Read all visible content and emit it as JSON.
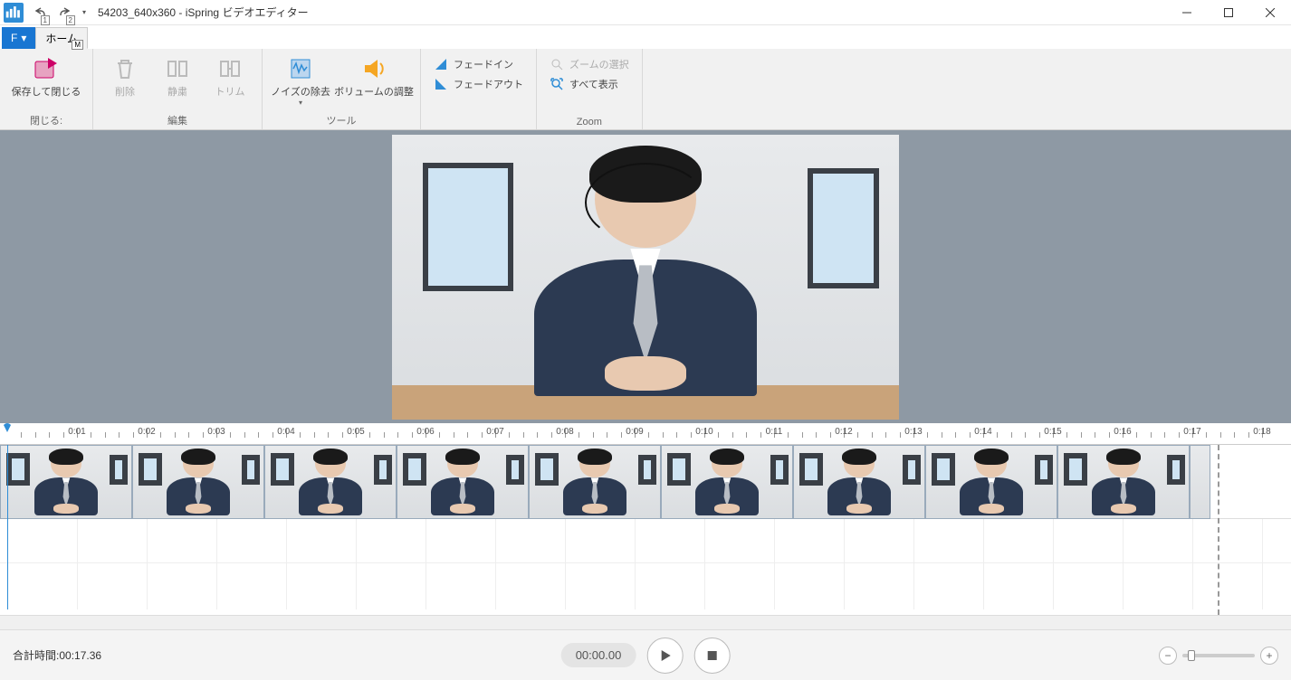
{
  "title": "54203_640x360 - iSpring ビデオエディター",
  "qat": {
    "undo_key": "1",
    "redo_key": "2"
  },
  "tabs": {
    "file": "F",
    "home_label": "ホーム",
    "home_key": "M"
  },
  "ribbon": {
    "close_group": {
      "label": "閉じる:",
      "save_close": "保存して閉じる"
    },
    "edit_group": {
      "label": "編集",
      "delete": "削除",
      "silence": "静粛",
      "trim": "トリム"
    },
    "tool_group": {
      "label": "ツール",
      "noise": "ノイズの除去",
      "volume": "ボリュームの調整"
    },
    "fade_group": {
      "fade_in": "フェードイン",
      "fade_out": "フェードアウト"
    },
    "zoom_group": {
      "label": "Zoom",
      "select": "ズームの選択",
      "show_all": "すべて表示"
    }
  },
  "ruler_ticks": [
    "0:01",
    "0:02",
    "0:03",
    "0:04",
    "0:05",
    "0:06",
    "0:07",
    "0:08",
    "0:09",
    "0:10",
    "0:11",
    "0:12",
    "0:13",
    "0:14",
    "0:15",
    "0:16",
    "0:17",
    "0:18"
  ],
  "timeline": {
    "pixels_per_second": 77,
    "clip_end_seconds": 17.36,
    "thumb_count": 9
  },
  "status": {
    "total_label": "合計時間:",
    "total_value": "00:17.36",
    "timecode": "00:00.00"
  }
}
